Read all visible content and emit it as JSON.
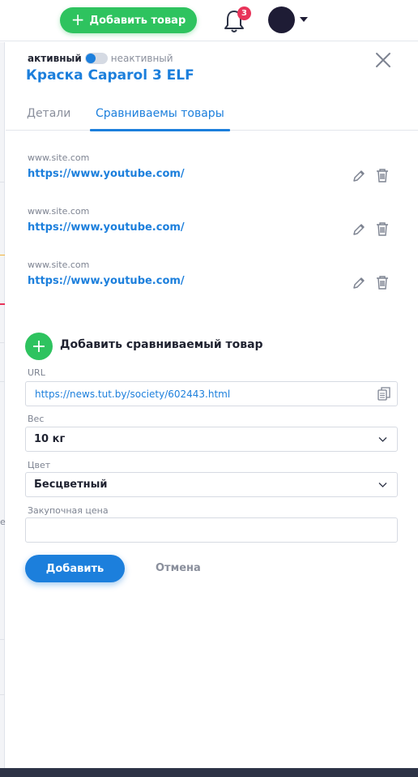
{
  "header": {
    "add_product_label": "Добавить товар",
    "notifications_count": "3"
  },
  "drawer": {
    "toggle": {
      "active_label": "активный",
      "inactive_label": "неактивный",
      "is_active": true
    },
    "title": "Краска Caparol 3 ELF",
    "tabs": [
      {
        "label": "Детали",
        "active": false
      },
      {
        "label": "Сравниваемы товары",
        "active": true
      }
    ],
    "items": [
      {
        "domain": "www.site.com",
        "url": "https://www.youtube.com/"
      },
      {
        "domain": "www.site.com",
        "url": "https://www.youtube.com/"
      },
      {
        "domain": "www.site.com",
        "url": "https://www.youtube.com/"
      }
    ],
    "add_compared_label": "Добавить сравниваемый товар",
    "form": {
      "url_label": "URL",
      "url_value": "https://news.tut.by/society/602443.html",
      "weight_label": "Вес",
      "weight_value": "10 кг",
      "color_label": "Цвет",
      "color_value": "Бесцветный",
      "price_label": "Закупочная цена",
      "price_value": ""
    },
    "submit_label": "Добавить",
    "cancel_label": "Отмена"
  },
  "background": {
    "partial_char": "e"
  },
  "colors": {
    "accent": "#1c7fdc",
    "success": "#2ec35f",
    "badge": "#e8345a",
    "avatar": "#1e1c35"
  }
}
